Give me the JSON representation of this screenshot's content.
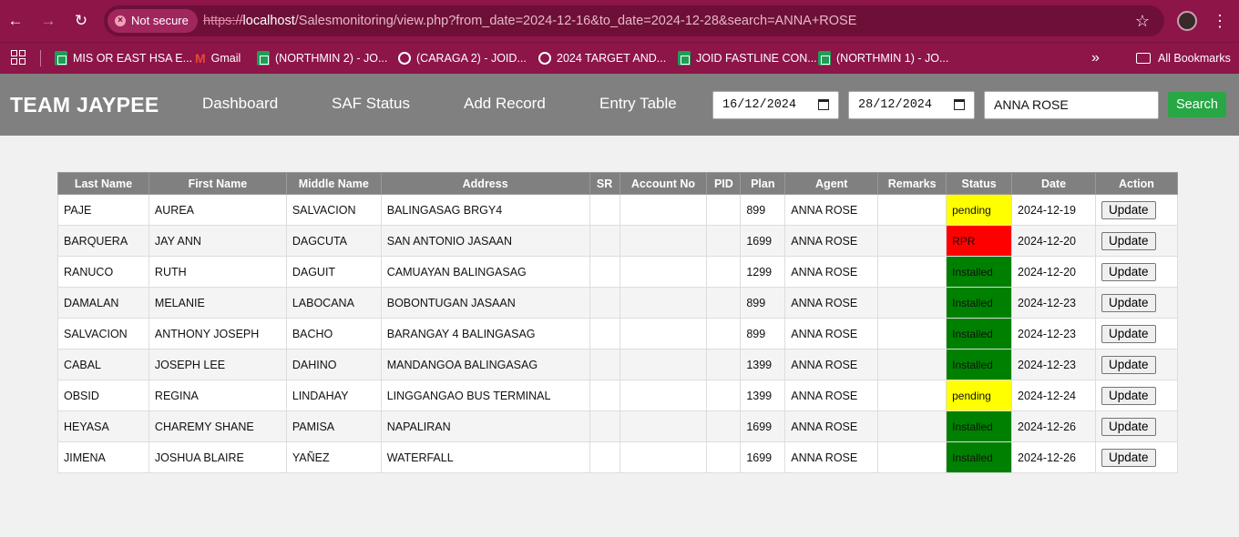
{
  "browser": {
    "security_label": "Not secure",
    "url_proto": "https://",
    "url_host": "localhost",
    "url_rest": "/Salesmonitoring/view.php?from_date=2024-12-16&to_date=2024-12-28&search=ANNA+ROSE",
    "bookmarks": [
      {
        "label": "MIS OR EAST HSA E...",
        "icon": "sheets-icon"
      },
      {
        "label": "Gmail",
        "icon": "gmail-icon"
      },
      {
        "label": "(NORTHMIN 2) - JO...",
        "icon": "sheets-icon"
      },
      {
        "label": "(CARAGA 2) - JOID...",
        "icon": "globe-icon"
      },
      {
        "label": "2024 TARGET AND...",
        "icon": "globe-icon"
      },
      {
        "label": "JOID FASTLINE CON...",
        "icon": "sheets-icon"
      },
      {
        "label": "(NORTHMIN 1) - JO...",
        "icon": "sheets-icon"
      }
    ],
    "more_label": "»",
    "all_bookmarks_label": "All Bookmarks"
  },
  "header": {
    "brand": "TEAM JAYPEE",
    "nav": [
      "Dashboard",
      "SAF Status",
      "Add Record",
      "Entry Table"
    ],
    "from_date": "16/12/2024",
    "to_date": "28/12/2024",
    "search_value": "ANNA ROSE",
    "search_button": "Search"
  },
  "table": {
    "columns": [
      "Last Name",
      "First Name",
      "Middle Name",
      "Address",
      "SR",
      "Account No",
      "PID",
      "Plan",
      "Agent",
      "Remarks",
      "Status",
      "Date",
      "Action"
    ],
    "rows": [
      {
        "last": "PAJE",
        "first": "AUREA",
        "middle": "SALVACION",
        "address": "BALINGASAG BRGY4",
        "sr": "",
        "account": "",
        "pid": "",
        "plan": "899",
        "agent": "ANNA ROSE",
        "remarks": "",
        "status": "pending",
        "date": "2024-12-19",
        "action": "Update"
      },
      {
        "last": "BARQUERA",
        "first": "JAY ANN",
        "middle": "DAGCUTA",
        "address": "SAN ANTONIO JASAAN",
        "sr": "",
        "account": "",
        "pid": "",
        "plan": "1699",
        "agent": "ANNA ROSE",
        "remarks": "",
        "status": "RPR",
        "date": "2024-12-20",
        "action": "Update"
      },
      {
        "last": "RANUCO",
        "first": "RUTH",
        "middle": "DAGUIT",
        "address": "CAMUAYAN BALINGASAG",
        "sr": "",
        "account": "",
        "pid": "",
        "plan": "1299",
        "agent": "ANNA ROSE",
        "remarks": "",
        "status": "Installed",
        "date": "2024-12-20",
        "action": "Update"
      },
      {
        "last": "DAMALAN",
        "first": "MELANIE",
        "middle": "LABOCANA",
        "address": "BOBONTUGAN JASAAN",
        "sr": "",
        "account": "",
        "pid": "",
        "plan": "899",
        "agent": "ANNA ROSE",
        "remarks": "",
        "status": "Installed",
        "date": "2024-12-23",
        "action": "Update"
      },
      {
        "last": "SALVACION",
        "first": "ANTHONY JOSEPH",
        "middle": "BACHO",
        "address": "BARANGAY 4 BALINGASAG",
        "sr": "",
        "account": "",
        "pid": "",
        "plan": "899",
        "agent": "ANNA ROSE",
        "remarks": "",
        "status": "Installed",
        "date": "2024-12-23",
        "action": "Update"
      },
      {
        "last": "CABAL",
        "first": "JOSEPH LEE",
        "middle": "DAHINO",
        "address": "MANDANGOA BALINGASAG",
        "sr": "",
        "account": "",
        "pid": "",
        "plan": "1399",
        "agent": "ANNA ROSE",
        "remarks": "",
        "status": "Installed",
        "date": "2024-12-23",
        "action": "Update"
      },
      {
        "last": "OBSID",
        "first": "REGINA",
        "middle": "LINDAHAY",
        "address": "LINGGANGAO BUS TERMINAL",
        "sr": "",
        "account": "",
        "pid": "",
        "plan": "1399",
        "agent": "ANNA ROSE",
        "remarks": "",
        "status": "pending",
        "date": "2024-12-24",
        "action": "Update"
      },
      {
        "last": "HEYASA",
        "first": "CHAREMY SHANE",
        "middle": "PAMISA",
        "address": "NAPALIRAN",
        "sr": "",
        "account": "",
        "pid": "",
        "plan": "1699",
        "agent": "ANNA ROSE",
        "remarks": "",
        "status": "Installed",
        "date": "2024-12-26",
        "action": "Update"
      },
      {
        "last": "JIMENA",
        "first": "JOSHUA BLAIRE",
        "middle": "YAÑEZ",
        "address": "WATERFALL",
        "sr": "",
        "account": "",
        "pid": "",
        "plan": "1699",
        "agent": "ANNA ROSE",
        "remarks": "",
        "status": "Installed",
        "date": "2024-12-26",
        "action": "Update"
      }
    ],
    "status_colors": {
      "pending": "#ffff00",
      "RPR": "#ff0000",
      "Installed": "#008000"
    }
  }
}
